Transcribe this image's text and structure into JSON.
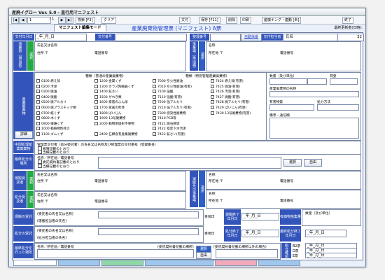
{
  "window": {
    "title": "産廃イグロー Ver. 5.0 - 直行用マニフェスト"
  },
  "toolbar": {
    "page_field": "1",
    "page_total": "/ 1",
    "search_label": "検索 [F3]",
    "clear_label": "クリア",
    "doc_label": "文付",
    "save_label": "保存 [F11]",
    "delete_label": "削除",
    "print_label": "印刷",
    "king_label": "産廃キング・連動 [未]",
    "exit_label": "終了"
  },
  "header": {
    "tab_label": "マニフェスト編集モード",
    "form_title": "産業廃棄物管理票 (マニフェスト) A票",
    "last_updated_label": "最終更新者(日時):"
  },
  "row_issue": {
    "date_label": "交付年月日",
    "date_value": "_年_月_日",
    "issue_no_label": "交付番号",
    "ref_no_label": "整理番号",
    "auto_label": "自動採番",
    "issuer_label": "交付担当者",
    "issuer_value": "氏名",
    "issuer_no": "32"
  },
  "generator": {
    "side_label": "事業者（排出者）",
    "name_label": "氏名又は名称",
    "address_label": "住所 〒",
    "phone_label": "電話番号",
    "site_side_label": "事業場（排出場）",
    "site_name_label": "名称",
    "site_address_label": "所在地 〒",
    "site_phone_label": "電話番号",
    "green_label": "選択"
  },
  "waste": {
    "side_label": "産業廃棄物",
    "detail_button": "詳細",
    "kind_header1": "種類（普通の産業廃棄物）",
    "kind_header2": "種類（特別管理産業廃棄物）",
    "quantity_label": "数量（及び単位）",
    "shape_label": "荷姿",
    "name_label": "産業廃棄物の名称",
    "harmful_label": "有害物質",
    "count_label": "処分方法",
    "remarks_label": "備考・通信欄",
    "col1": [
      "0100 燃え殻",
      "0200 汚泥",
      "0300 廃油",
      "0400 廃酸",
      "0500 廃アルカリ",
      "0600 廃プラスチック類",
      "0700 紙くず",
      "0800 木くず",
      "0900 繊維くず",
      "1000 動植物性残さ",
      "1100 ゴムくず"
    ],
    "col2": [
      "1200 金属くず",
      "1300 ガラス陶磁器くず",
      "1400 鉱さい",
      "1500 がれき類",
      "1600 家畜のふん尿",
      "1700 家畜の死体",
      "1800 ばいじん",
      "1900 13号廃棄物",
      "2000 動物系固形不要物",
      "",
      "2400 石綿含有産業廃棄物"
    ],
    "col3": [
      "7000 引火性廃油",
      "7010 引火性廃油(有害)",
      "7100 強酸",
      "7110 強酸(有害)",
      "7200 強アルカリ",
      "7210 強アルカリ(有害)",
      "7300 感染性廃棄物",
      "7410 PCB等",
      "7421 廃石綿等",
      "7422 指定下水汚泥",
      "7423 鉱さい(有害)"
    ],
    "col4": [
      "7424 燃え殻(有害)",
      "7425 廃油(有害)",
      "7426 汚泥(有害)",
      "7427 廃酸(有害)",
      "7428 廃アルカリ(有害)",
      "7429 ばいじん(有害)",
      "7430 13号廃棄物(有害)"
    ]
  },
  "middle": {
    "mid_label": "中間処理産業廃棄物",
    "mid_text1": "管理票交付者（処分委託者）の氏名又は名称及び管理票の交付番号（登録番号）",
    "mid_text2": "帳簿記載のとおり",
    "mid_text3": "当欄記載のとおり",
    "final_label": "最終処分の場所",
    "final_text1": "名称／所在地／電話番号",
    "final_text2": "委託契約書記載のとおり",
    "final_text3": "当欄記載のとおり",
    "select_button": "選択",
    "free_button": "自由"
  },
  "transport": {
    "side_label": "運搬受託者",
    "name_label": "氏名又は名称",
    "address_label": "住所 〒",
    "phone_label": "電話番号",
    "dest_side_label": "運搬先の事業場",
    "dest_name_label": "名称",
    "dest_address_label": "所在地 〒",
    "dest_phone_label": "電話番号",
    "green_label": "選択"
  },
  "disposal": {
    "side_label": "処分受託者",
    "name_label": "氏名又は名称",
    "address_label": "住所 〒",
    "phone_label": "電話番号",
    "dest_side_label": "積替え又は保管",
    "dest_name_label": "名称",
    "dest_address_label": "所在地 〒",
    "dest_phone_label": "電話番号",
    "green_label": "選択"
  },
  "receipt": {
    "transport_label": "運搬の受託",
    "transport_text1": "(受託者の氏名又は名称)",
    "transport_text2": "(運搬担当者の氏名)",
    "disposal_label": "処分の受託",
    "disposal_text1": "(受託者の氏名又は名称)",
    "disposal_text2": "(処分担当者の氏名)",
    "stamp1": "受領印",
    "stamp2": "受領印",
    "end_label1": "運搬終了年月日",
    "end_label2": "処分終了年月日",
    "end_value1": "_年_月_日",
    "end_value2": "_年_月_日",
    "valuable_label": "有価物拾集量",
    "qty_label": "数量（及び単位）",
    "final_end_label": "最終処分終了年月日",
    "final_end_value": "_年_月_日"
  },
  "final_row": {
    "label": "最終処分を行った場所",
    "text": "名称／所在地／電話番号",
    "text2": "(委託契約書記載の場所)",
    "text3": "(委託契約書記載の場所以外の場合)",
    "choose_button": "選択",
    "free_button": "自由",
    "check_label": "照合確認",
    "b2_label": "B2票",
    "d_label": "D票",
    "e_label": "E票",
    "b2_value": "_年_月_日",
    "d_value": "_年_月_日",
    "e_value": "_年_月_日"
  }
}
